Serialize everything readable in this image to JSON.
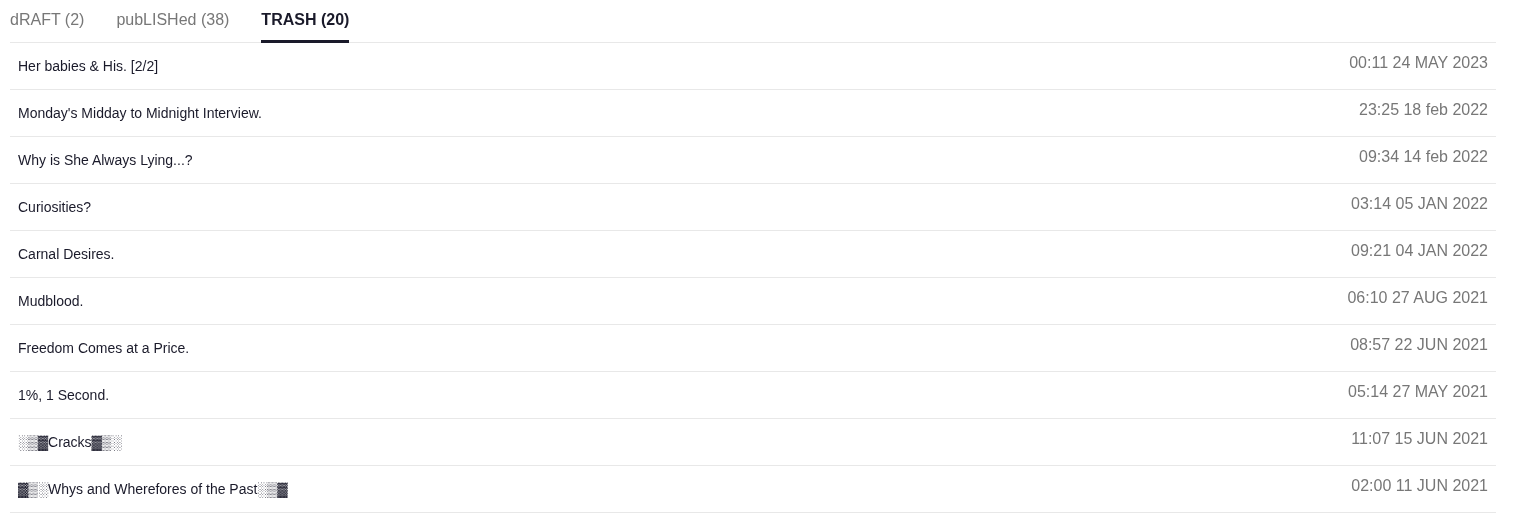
{
  "tabs": [
    {
      "label": "dRAFT (2)",
      "selected": false
    },
    {
      "label": "pubLISHed (38)",
      "selected": false
    },
    {
      "label": "TRASH (20)",
      "selected": true
    }
  ],
  "rows": [
    {
      "title": "Her babies & His. [2/2]",
      "date": "00:11 24 MAY 2023"
    },
    {
      "title": "Monday's Midday to Midnight Interview.",
      "date": "23:25 18 feb 2022"
    },
    {
      "title": "Why is She Always Lying...?",
      "date": "09:34 14 feb 2022"
    },
    {
      "title": "Curiosities?",
      "date": "03:14 05 JAN 2022"
    },
    {
      "title": "Carnal Desires.",
      "date": "09:21 04 JAN 2022"
    },
    {
      "title": "Mudblood.",
      "date": "06:10 27 AUG 2021"
    },
    {
      "title": "Freedom Comes at a Price.",
      "date": "08:57 22 JUN 2021"
    },
    {
      "title": "1%, 1 Second.",
      "date": "05:14 27 MAY 2021"
    },
    {
      "title": "░▒▓Cracks▓▒░",
      "date": "11:07 15 JUN 2021"
    },
    {
      "title": "▓▒░Whys and Wherefores of the Past░▒▓",
      "date": "02:00 11 JUN 2021"
    }
  ]
}
